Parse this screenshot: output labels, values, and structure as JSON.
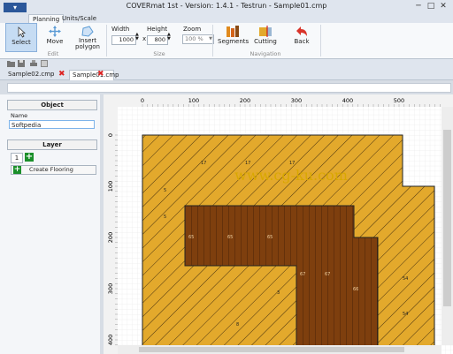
{
  "window": {
    "title": "COVERmat 1st - Version: 1.4.1 - Testrun - Sample01.cmp",
    "minimize": "─",
    "maximize": "□",
    "close": "✕"
  },
  "app_menu": {
    "label": "▾"
  },
  "tabs": [
    {
      "label": "Planning",
      "active": true
    },
    {
      "label": "Units/Scale",
      "active": false
    }
  ],
  "ribbon": {
    "edit": {
      "label": "Edit",
      "select": "Select",
      "move": "Move",
      "insert_polygon": "Insert polygon"
    },
    "size": {
      "label": "Size",
      "width_label": "Width",
      "width_value": "1000",
      "height_label": "Height",
      "height_value": "800",
      "times": "x",
      "zoom_label": "Zoom",
      "zoom_value": "100 %"
    },
    "navigation": {
      "label": "Navigation",
      "segments": "Segments",
      "cutting": "Cutting",
      "back": "Back"
    }
  },
  "doc_tabs": [
    {
      "label": "Sample02.cmp",
      "active": false
    },
    {
      "label": "Sample01.cmp",
      "active": true
    }
  ],
  "left_panel": {
    "object_header": "Object",
    "name_label": "Name",
    "name_value": "Softpedia",
    "layer_header": "Layer",
    "layer_number": "1",
    "create_flooring": "Create Flooring"
  },
  "canvas": {
    "watermark": "www.cg-ku.com",
    "ruler_x": [
      "0",
      "100",
      "200",
      "300",
      "400",
      "500"
    ],
    "ruler_y": [
      "0",
      "100",
      "200",
      "300",
      "400"
    ],
    "colors": {
      "hatch_fill": "#e3a92c",
      "hatch_line": "#4a3410",
      "wood_fill": "#7e3f0e",
      "wood_line": "#3e1c06",
      "watermark": "#d9a800"
    },
    "board_labels": {
      "top": "17",
      "wood_row": "65",
      "wood_lower": "67",
      "wood_right": "66",
      "hatch_left": "5",
      "hatch_right": "54",
      "hatch_bottom": "8",
      "hatch_mid": "3"
    }
  }
}
